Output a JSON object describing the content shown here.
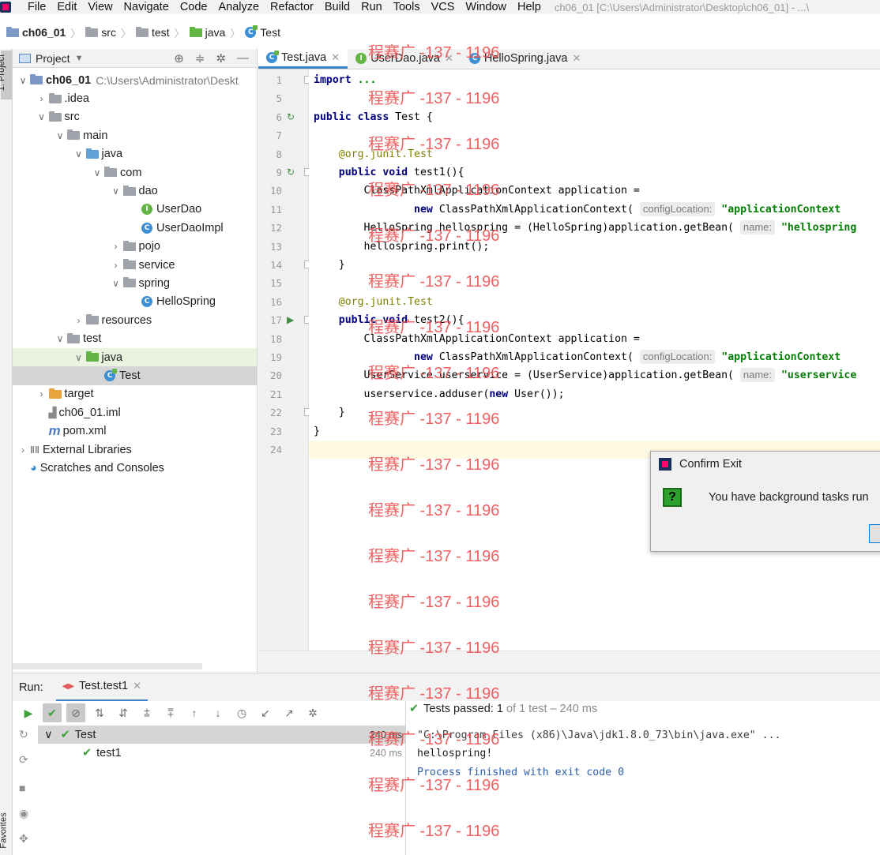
{
  "menubar": {
    "items": [
      "File",
      "Edit",
      "View",
      "Navigate",
      "Code",
      "Analyze",
      "Refactor",
      "Build",
      "Run",
      "Tools",
      "VCS",
      "Window",
      "Help"
    ],
    "window_title": "ch06_01 [C:\\Users\\Administrator\\Desktop\\ch06_01] - ...\\"
  },
  "breadcrumb": [
    "ch06_01",
    "src",
    "test",
    "java",
    "Test"
  ],
  "left_strip": {
    "project_label": "1: Project",
    "favorites_label": "Favorites"
  },
  "project_panel": {
    "title": "Project",
    "tree": [
      {
        "label": "ch06_01",
        "path": "C:\\Users\\Administrator\\Deskt",
        "depth": 0,
        "arrow": "open",
        "icon": "module-folder",
        "bold": true
      },
      {
        "label": ".idea",
        "depth": 1,
        "arrow": "closed",
        "icon": "folder"
      },
      {
        "label": "src",
        "depth": 1,
        "arrow": "open",
        "icon": "folder"
      },
      {
        "label": "main",
        "depth": 2,
        "arrow": "open",
        "icon": "folder"
      },
      {
        "label": "java",
        "depth": 3,
        "arrow": "open",
        "icon": "source-folder"
      },
      {
        "label": "com",
        "depth": 4,
        "arrow": "open",
        "icon": "package"
      },
      {
        "label": "dao",
        "depth": 5,
        "arrow": "open",
        "icon": "package"
      },
      {
        "label": "UserDao",
        "depth": 6,
        "arrow": "none",
        "icon": "interface"
      },
      {
        "label": "UserDaoImpl",
        "depth": 6,
        "arrow": "none",
        "icon": "class"
      },
      {
        "label": "pojo",
        "depth": 5,
        "arrow": "closed",
        "icon": "package"
      },
      {
        "label": "service",
        "depth": 5,
        "arrow": "closed",
        "icon": "package"
      },
      {
        "label": "spring",
        "depth": 5,
        "arrow": "open",
        "icon": "package"
      },
      {
        "label": "HelloSpring",
        "depth": 6,
        "arrow": "none",
        "icon": "class"
      },
      {
        "label": "resources",
        "depth": 3,
        "arrow": "closed",
        "icon": "resources-folder"
      },
      {
        "label": "test",
        "depth": 2,
        "arrow": "open",
        "icon": "folder"
      },
      {
        "label": "java",
        "depth": 3,
        "arrow": "open",
        "icon": "test-folder",
        "highlight": true
      },
      {
        "label": "Test",
        "depth": 4,
        "arrow": "none",
        "icon": "test-class",
        "selected": true
      },
      {
        "label": "target",
        "depth": 1,
        "arrow": "closed",
        "icon": "excluded-folder"
      },
      {
        "label": "ch06_01.iml",
        "depth": 1,
        "arrow": "none",
        "icon": "iml-file"
      },
      {
        "label": "pom.xml",
        "depth": 1,
        "arrow": "none",
        "icon": "maven-file"
      },
      {
        "label": "External Libraries",
        "depth": 0,
        "arrow": "closed",
        "icon": "library"
      },
      {
        "label": "Scratches and Consoles",
        "depth": 0,
        "arrow": "none",
        "icon": "scratches"
      }
    ]
  },
  "editor": {
    "tabs": [
      {
        "label": "Test.java",
        "icon": "test-class",
        "active": true
      },
      {
        "label": "UserDao.java",
        "icon": "interface",
        "active": false
      },
      {
        "label": "HelloSpring.java",
        "icon": "class",
        "active": false
      }
    ],
    "lines": [
      {
        "num": "1",
        "fold": true,
        "segments": [
          [
            "kw",
            "import"
          ],
          [
            "",
            " "
          ],
          [
            "str",
            "..."
          ]
        ]
      },
      {
        "num": "5",
        "segments": []
      },
      {
        "num": "6",
        "gutter_icon": "run-class-icon",
        "segments": [
          [
            "kw",
            "public class"
          ],
          [
            "",
            " Test {"
          ]
        ]
      },
      {
        "num": "7",
        "segments": []
      },
      {
        "num": "8",
        "segments": [
          [
            "",
            "    "
          ],
          [
            "ann",
            "@org.junit.Test"
          ]
        ]
      },
      {
        "num": "9",
        "gutter_icon": "run-class-icon",
        "fold": true,
        "segments": [
          [
            "",
            "    "
          ],
          [
            "kw",
            "public void"
          ],
          [
            "",
            " test1(){"
          ]
        ]
      },
      {
        "num": "10",
        "segments": [
          [
            "",
            "        ClassPathXmlApplicationContext application ="
          ]
        ]
      },
      {
        "num": "11",
        "segments": [
          [
            "",
            "                "
          ],
          [
            "kw",
            "new"
          ],
          [
            "",
            " ClassPathXmlApplicationContext( "
          ],
          [
            "hint",
            "configLocation:"
          ],
          [
            "",
            " "
          ],
          [
            "str",
            "\"applicationContext"
          ]
        ]
      },
      {
        "num": "12",
        "segments": [
          [
            "",
            "        HelloSpring hellospring = (HelloSpring)application.getBean( "
          ],
          [
            "hint",
            "name:"
          ],
          [
            "",
            " "
          ],
          [
            "str",
            "\"hellospring"
          ]
        ]
      },
      {
        "num": "13",
        "segments": [
          [
            "",
            "        hellospring.print();"
          ]
        ]
      },
      {
        "num": "14",
        "fold": true,
        "segments": [
          [
            "",
            "    }"
          ]
        ]
      },
      {
        "num": "15",
        "segments": []
      },
      {
        "num": "16",
        "segments": [
          [
            "",
            "    "
          ],
          [
            "ann",
            "@org.junit.Test"
          ]
        ]
      },
      {
        "num": "17",
        "gutter_icon": "run-method-icon",
        "fold": true,
        "segments": [
          [
            "",
            "    "
          ],
          [
            "kw",
            "public void"
          ],
          [
            "",
            " test2(){"
          ]
        ]
      },
      {
        "num": "18",
        "segments": [
          [
            "",
            "        ClassPathXmlApplicationContext application ="
          ]
        ]
      },
      {
        "num": "19",
        "segments": [
          [
            "",
            "                "
          ],
          [
            "kw",
            "new"
          ],
          [
            "",
            " ClassPathXmlApplicationContext( "
          ],
          [
            "hint",
            "configLocation:"
          ],
          [
            "",
            " "
          ],
          [
            "str",
            "\"applicationContext"
          ]
        ]
      },
      {
        "num": "20",
        "segments": [
          [
            "",
            "        UserService userservice = (UserService)application.getBean( "
          ],
          [
            "hint",
            "name:"
          ],
          [
            "",
            " "
          ],
          [
            "str",
            "\"userservice"
          ]
        ]
      },
      {
        "num": "21",
        "segments": [
          [
            "",
            "        userservice.adduser("
          ],
          [
            "kw",
            "new"
          ],
          [
            "",
            " User());"
          ]
        ]
      },
      {
        "num": "22",
        "fold": true,
        "segments": [
          [
            "",
            "    }"
          ]
        ]
      },
      {
        "num": "23",
        "segments": [
          [
            "",
            "}"
          ]
        ]
      },
      {
        "num": "24",
        "current": true,
        "segments": []
      }
    ]
  },
  "dialog": {
    "title": "Confirm Exit",
    "icon": "?",
    "message": "You have background tasks run"
  },
  "run_panel": {
    "label": "Run:",
    "tab": "Test.test1",
    "status_prefix": "Tests passed:",
    "status_count": "1",
    "status_suffix": "of 1 test – 240 ms",
    "tree": [
      {
        "label": "Test",
        "time": "240 ms",
        "depth": 0,
        "selected": true
      },
      {
        "label": "test1",
        "time": "240 ms",
        "depth": 1,
        "selected": false
      }
    ],
    "console": [
      {
        "text": "\"C:\\Program Files (x86)\\Java\\jdk1.8.0_73\\bin\\java.exe\" ...",
        "type": "cmd"
      },
      {
        "text": "hellospring!",
        "type": "out"
      },
      {
        "text": "Process finished with exit code 0",
        "type": "exit"
      }
    ]
  },
  "watermark": "程赛广 -137 - 1196"
}
